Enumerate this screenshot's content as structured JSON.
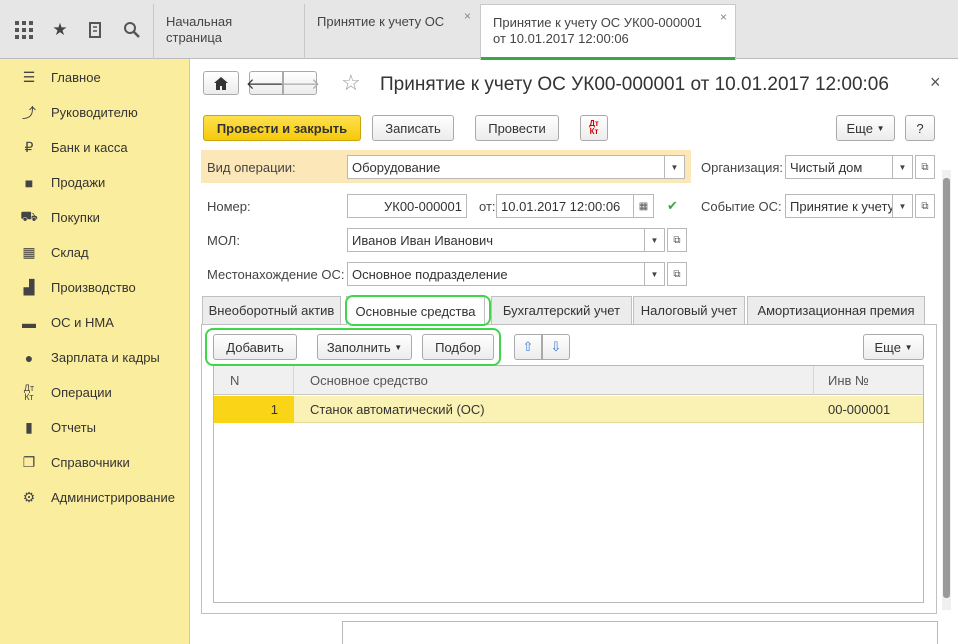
{
  "tabs": [
    {
      "label": "Начальная страница"
    },
    {
      "label": "Принятие к учету ОС",
      "close": "×"
    },
    {
      "label_line1": "Принятие к учету ОС УК00-000001",
      "label_line2": "от 10.01.2017 12:00:06",
      "close": "×"
    }
  ],
  "sidebar": {
    "items": [
      {
        "label": "Главное",
        "icon": "menu-icon"
      },
      {
        "label": "Руководителю",
        "icon": "trend-icon"
      },
      {
        "label": "Банк и касса",
        "icon": "ruble-icon"
      },
      {
        "label": "Продажи",
        "icon": "bag-icon"
      },
      {
        "label": "Покупки",
        "icon": "cart-icon"
      },
      {
        "label": "Склад",
        "icon": "warehouse-icon"
      },
      {
        "label": "Производство",
        "icon": "factory-icon"
      },
      {
        "label": "ОС и НМА",
        "icon": "truck-icon"
      },
      {
        "label": "Зарплата и кадры",
        "icon": "person-icon"
      },
      {
        "label": "Операции",
        "icon": "dtkt-icon"
      },
      {
        "label": "Отчеты",
        "icon": "bar-chart-icon"
      },
      {
        "label": "Справочники",
        "icon": "book-icon"
      },
      {
        "label": "Администрирование",
        "icon": "gear-icon"
      }
    ]
  },
  "document": {
    "title": "Принятие к учету ОС УК00-000001 от 10.01.2017 12:00:06",
    "close": "×"
  },
  "toolbar": {
    "post_close": "Провести и закрыть",
    "save": "Записать",
    "post": "Провести",
    "more": "Еще",
    "help": "?"
  },
  "form": {
    "operation_label": "Вид операции:",
    "operation_value": "Оборудование",
    "org_label": "Организация:",
    "org_value": "Чистый дом",
    "number_label": "Номер:",
    "number_value": "УК00-000001",
    "date_label": "от:",
    "date_value": "10.01.2017 12:00:06",
    "event_label": "Событие ОС:",
    "event_value": "Принятие к учету",
    "mol_label": "МОЛ:",
    "mol_value": "Иванов Иван Иванович",
    "location_label": "Местонахождение ОС:",
    "location_value": "Основное подразделение"
  },
  "form_tabs": [
    "Внеоборотный актив",
    "Основные средства",
    "Бухгалтерский учет",
    "Налоговый учет",
    "Амортизационная премия"
  ],
  "table_toolbar": {
    "add": "Добавить",
    "fill": "Заполнить",
    "pick": "Подбор",
    "more": "Еще"
  },
  "table": {
    "columns": [
      "N",
      "Основное средство",
      "Инв №"
    ],
    "rows": [
      {
        "n": "1",
        "asset": "Станок автоматический (ОС)",
        "inv": "00-000001"
      }
    ]
  },
  "colors": {
    "sidebar_bg": "#fbed9e",
    "accent_green": "#3fd64a",
    "primary_button": "#f6c90b",
    "selected_row": "#faf1b4"
  }
}
